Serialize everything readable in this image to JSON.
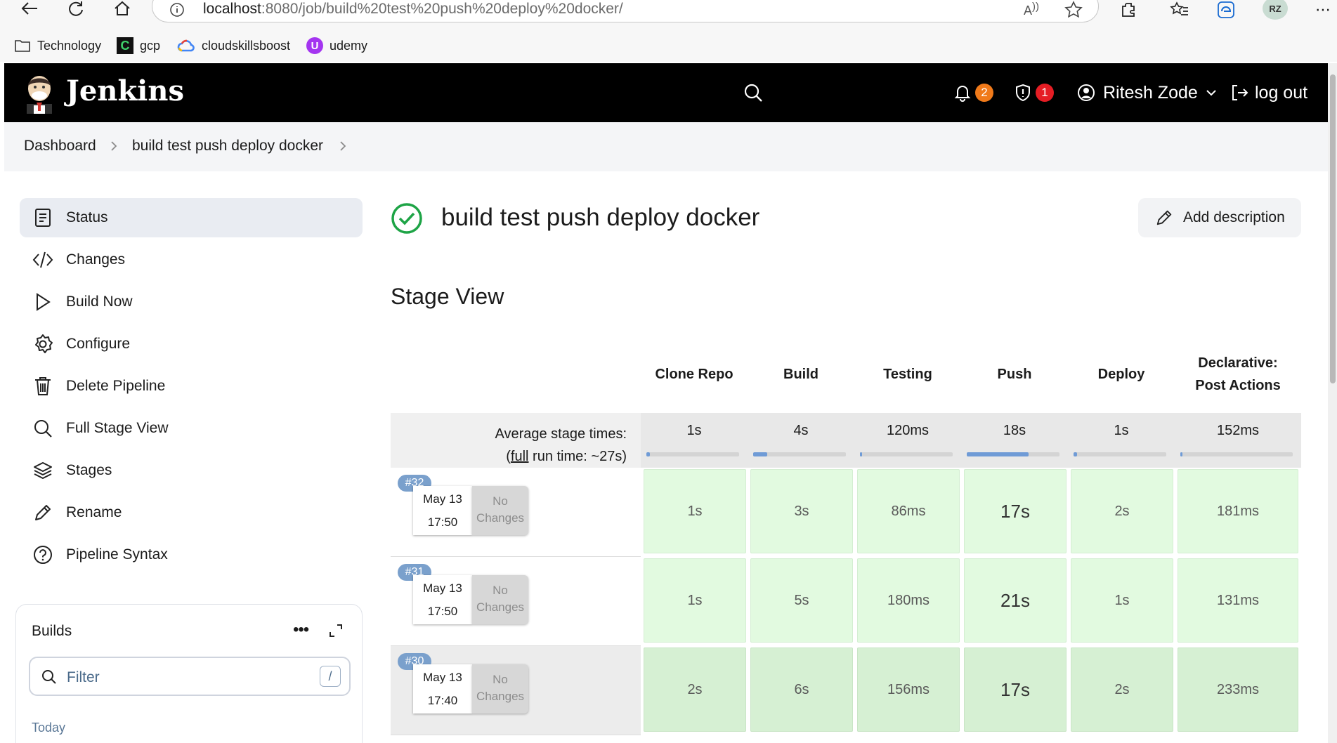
{
  "browser": {
    "url_host": "localhost",
    "url_path": ":8080/job/build%20test%20push%20deploy%20docker/",
    "avatar_initials": "RZ",
    "bookmarks": [
      "Technology",
      "gcp",
      "cloudskillsboost",
      "udemy"
    ]
  },
  "header": {
    "title": "Jenkins",
    "notifications_count": "2",
    "security_count": "1",
    "user_name": "Ritesh Zode",
    "logout_label": "log out",
    "notif_color": "#f07a1a",
    "security_color": "#e51d24"
  },
  "breadcrumb": [
    "Dashboard",
    "build test push deploy docker"
  ],
  "sidebar": {
    "items": [
      {
        "label": "Status",
        "icon": "status-icon",
        "active": true
      },
      {
        "label": "Changes",
        "icon": "code-icon"
      },
      {
        "label": "Build Now",
        "icon": "play-icon"
      },
      {
        "label": "Configure",
        "icon": "gear-icon"
      },
      {
        "label": "Delete Pipeline",
        "icon": "trash-icon"
      },
      {
        "label": "Full Stage View",
        "icon": "search-icon"
      },
      {
        "label": "Stages",
        "icon": "stack-icon"
      },
      {
        "label": "Rename",
        "icon": "pencil-icon"
      },
      {
        "label": "Pipeline Syntax",
        "icon": "help-icon"
      }
    ]
  },
  "builds": {
    "title": "Builds",
    "filter_placeholder": "Filter",
    "filter_shortcut": "/",
    "today_label": "Today"
  },
  "main": {
    "title": "build test push deploy docker",
    "add_description": "Add description",
    "stage_view_title": "Stage View",
    "status_color": "#1ea446"
  },
  "stage_view": {
    "stages": [
      "Clone Repo",
      "Build",
      "Testing",
      "Push",
      "Deploy",
      "Declarative: Post Actions"
    ],
    "avg_label": "Average stage times:",
    "full_run_prefix": "(",
    "full_run_link": "full",
    "full_run_suffix": " run time: ~27s)",
    "avg_times": [
      "1s",
      "4s",
      "120ms",
      "18s",
      "1s",
      "152ms"
    ],
    "avg_fraction": [
      0.04,
      0.15,
      0.005,
      0.67,
      0.04,
      0.006
    ],
    "runs": [
      {
        "id": "#32",
        "date": "May 13",
        "time": "17:50",
        "changes": "No Changes",
        "times": [
          "1s",
          "3s",
          "86ms",
          "17s",
          "2s",
          "181ms"
        ]
      },
      {
        "id": "#31",
        "date": "May 13",
        "time": "17:50",
        "changes": "No Changes",
        "times": [
          "1s",
          "5s",
          "180ms",
          "21s",
          "1s",
          "131ms"
        ]
      },
      {
        "id": "#30",
        "date": "May 13",
        "time": "17:40",
        "changes": "No Changes",
        "times": [
          "2s",
          "6s",
          "156ms",
          "17s",
          "2s",
          "233ms"
        ]
      }
    ]
  }
}
